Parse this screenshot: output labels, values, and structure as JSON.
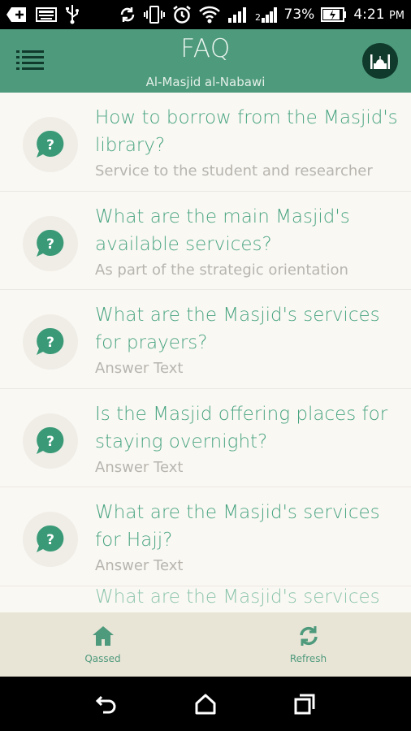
{
  "status_bar": {
    "battery_percent": "73%",
    "time": "4:21",
    "time_suffix": "PM"
  },
  "header": {
    "title": "FAQ",
    "subtitle": "Al-Masjid al-Nabawi"
  },
  "faq_items": [
    {
      "title": "How to borrow from the Masjid's library?",
      "subtitle": "Service to the student and researcher"
    },
    {
      "title": "What are the main Masjid's available services?",
      "subtitle": "As part of the strategic orientation"
    },
    {
      "title": "What are the Masjid's services for prayers?",
      "subtitle": "Answer Text"
    },
    {
      "title": "Is the Masjid offering places for staying overnight?",
      "subtitle": "Answer Text"
    },
    {
      "title": "What are the Masjid's services for Hajj?",
      "subtitle": "Answer Text"
    },
    {
      "title": "What are the Masjid's services for",
      "subtitle": ""
    }
  ],
  "tabs": [
    {
      "label": "Qassed",
      "icon": "home-icon"
    },
    {
      "label": "Refresh",
      "icon": "refresh-icon"
    }
  ],
  "colors": {
    "accent": "#4e9a7c",
    "title_text": "#4aa583",
    "list_bg": "#faf8f3",
    "tab_bar_bg": "#e8e4d6"
  }
}
